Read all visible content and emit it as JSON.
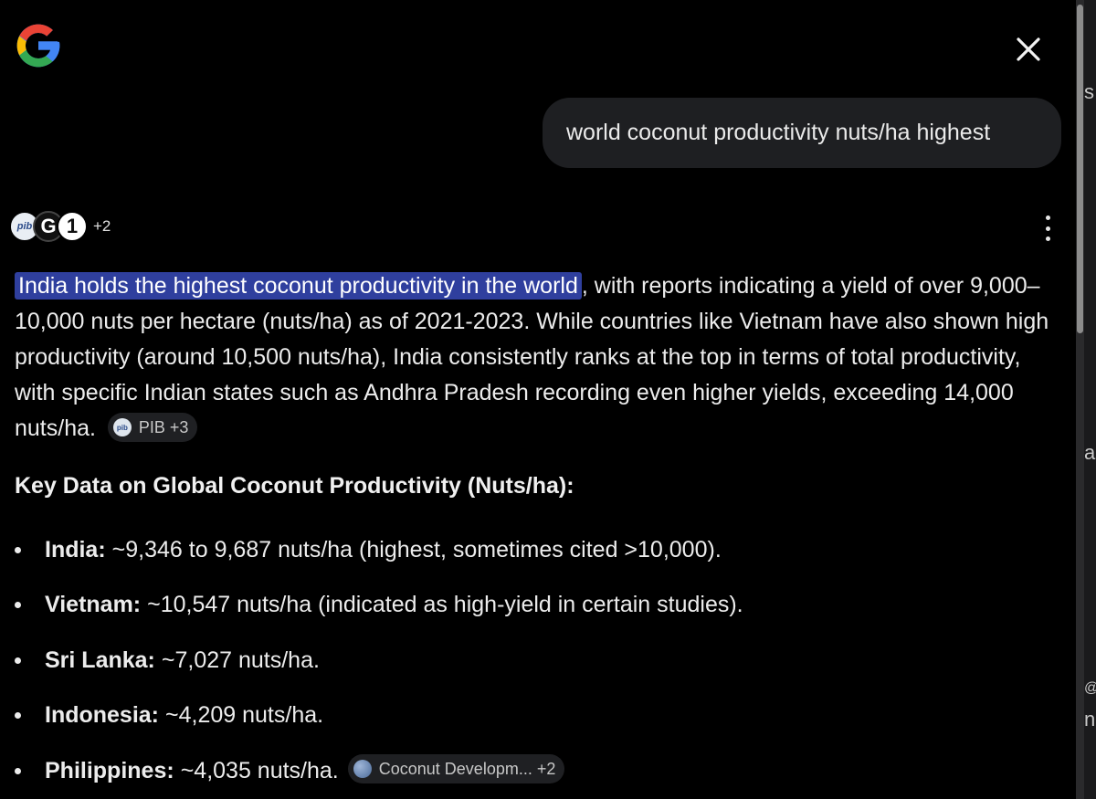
{
  "query": "world coconut productivity nuts/ha highest",
  "sources": {
    "more_count": "+2",
    "icons": [
      "pib-icon",
      "g1-icon",
      "d-icon"
    ]
  },
  "answer": {
    "highlight": "India holds the highest coconut productivity in the world",
    "rest": ", with reports indicating a yield of over 9,000–10,000 nuts per hectare (nuts/ha) as of 2021-2023. While countries like Vietnam have also shown high productivity (around 10,500 nuts/ha), India consistently ranks at the top in terms of total productivity, with specific Indian states such as Andhra Pradesh recording even higher yields, exceeding 14,000 nuts/ha.",
    "citation": "PIB +3"
  },
  "key_data": {
    "heading": "Key Data on Global Coconut Productivity (Nuts/ha):",
    "items": [
      {
        "country": "India:",
        "text": "~9,346 to 9,687 nuts/ha (highest, sometimes cited >10,000)."
      },
      {
        "country": "Vietnam:",
        "text": "~10,547 nuts/ha (indicated as high-yield in certain studies)."
      },
      {
        "country": "Sri Lanka:",
        "text": "~7,027 nuts/ha."
      },
      {
        "country": "Indonesia:",
        "text": "~4,209 nuts/ha."
      },
      {
        "country": "Philippines:",
        "text": "~4,035 nuts/ha.",
        "citation": "Coconut Developm... +2"
      }
    ]
  },
  "edge_text": [
    "s",
    "a",
    "@",
    "n"
  ],
  "colors": {
    "background": "#000000",
    "highlight": "#2f3f9e",
    "bubble": "#1e1f22"
  }
}
